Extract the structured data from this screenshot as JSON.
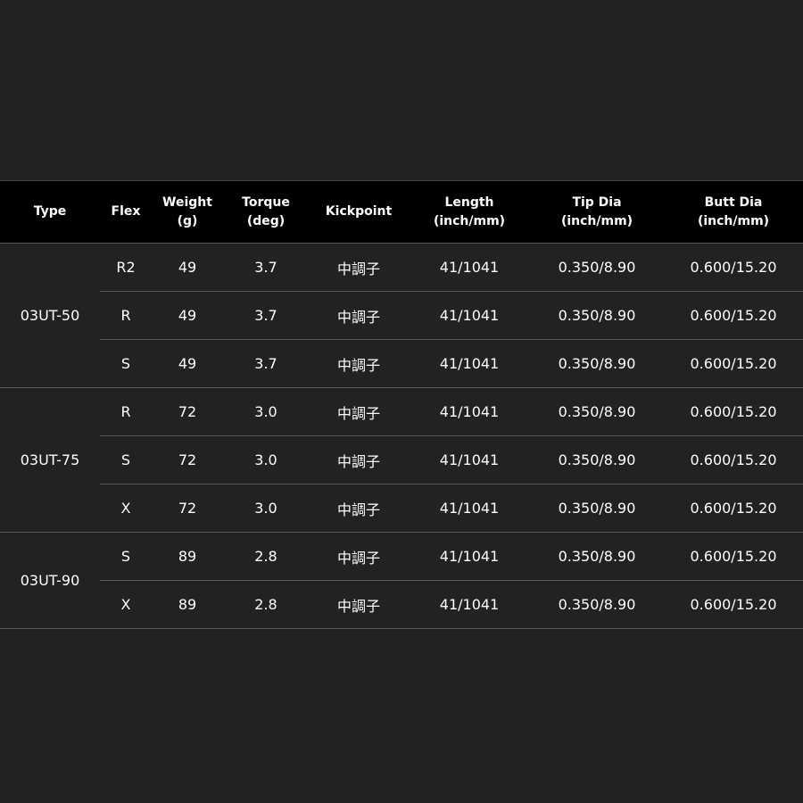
{
  "headers": {
    "type": [
      "Type"
    ],
    "flex": [
      "Flex"
    ],
    "weight": [
      "Weight",
      "(g)"
    ],
    "torque": [
      "Torque",
      "(deg)"
    ],
    "kickpoint": [
      "Kickpoint"
    ],
    "length": [
      "Length",
      "(inch/mm)"
    ],
    "tip_dia": [
      "Tip Dia",
      "(inch/mm)"
    ],
    "butt_dia": [
      "Butt Dia",
      "(inch/mm)"
    ]
  },
  "groups": [
    {
      "type": "03UT-50",
      "rows": [
        {
          "flex": "R2",
          "weight": "49",
          "torque": "3.7",
          "kickpoint": "中調子",
          "length": "41/1041",
          "tip_dia": "0.350/8.90",
          "butt_dia": "0.600/15.20"
        },
        {
          "flex": "R",
          "weight": "49",
          "torque": "3.7",
          "kickpoint": "中調子",
          "length": "41/1041",
          "tip_dia": "0.350/8.90",
          "butt_dia": "0.600/15.20"
        },
        {
          "flex": "S",
          "weight": "49",
          "torque": "3.7",
          "kickpoint": "中調子",
          "length": "41/1041",
          "tip_dia": "0.350/8.90",
          "butt_dia": "0.600/15.20"
        }
      ]
    },
    {
      "type": "03UT-75",
      "rows": [
        {
          "flex": "R",
          "weight": "72",
          "torque": "3.0",
          "kickpoint": "中調子",
          "length": "41/1041",
          "tip_dia": "0.350/8.90",
          "butt_dia": "0.600/15.20"
        },
        {
          "flex": "S",
          "weight": "72",
          "torque": "3.0",
          "kickpoint": "中調子",
          "length": "41/1041",
          "tip_dia": "0.350/8.90",
          "butt_dia": "0.600/15.20"
        },
        {
          "flex": "X",
          "weight": "72",
          "torque": "3.0",
          "kickpoint": "中調子",
          "length": "41/1041",
          "tip_dia": "0.350/8.90",
          "butt_dia": "0.600/15.20"
        }
      ]
    },
    {
      "type": "03UT-90",
      "rows": [
        {
          "flex": "S",
          "weight": "89",
          "torque": "2.8",
          "kickpoint": "中調子",
          "length": "41/1041",
          "tip_dia": "0.350/8.90",
          "butt_dia": "0.600/15.20"
        },
        {
          "flex": "X",
          "weight": "89",
          "torque": "2.8",
          "kickpoint": "中調子",
          "length": "41/1041",
          "tip_dia": "0.350/8.90",
          "butt_dia": "0.600/15.20"
        }
      ]
    }
  ],
  "colors": {
    "background": "#222222",
    "header_background": "#000000",
    "text": "#ffffff",
    "divider": "#5a5a5a"
  }
}
